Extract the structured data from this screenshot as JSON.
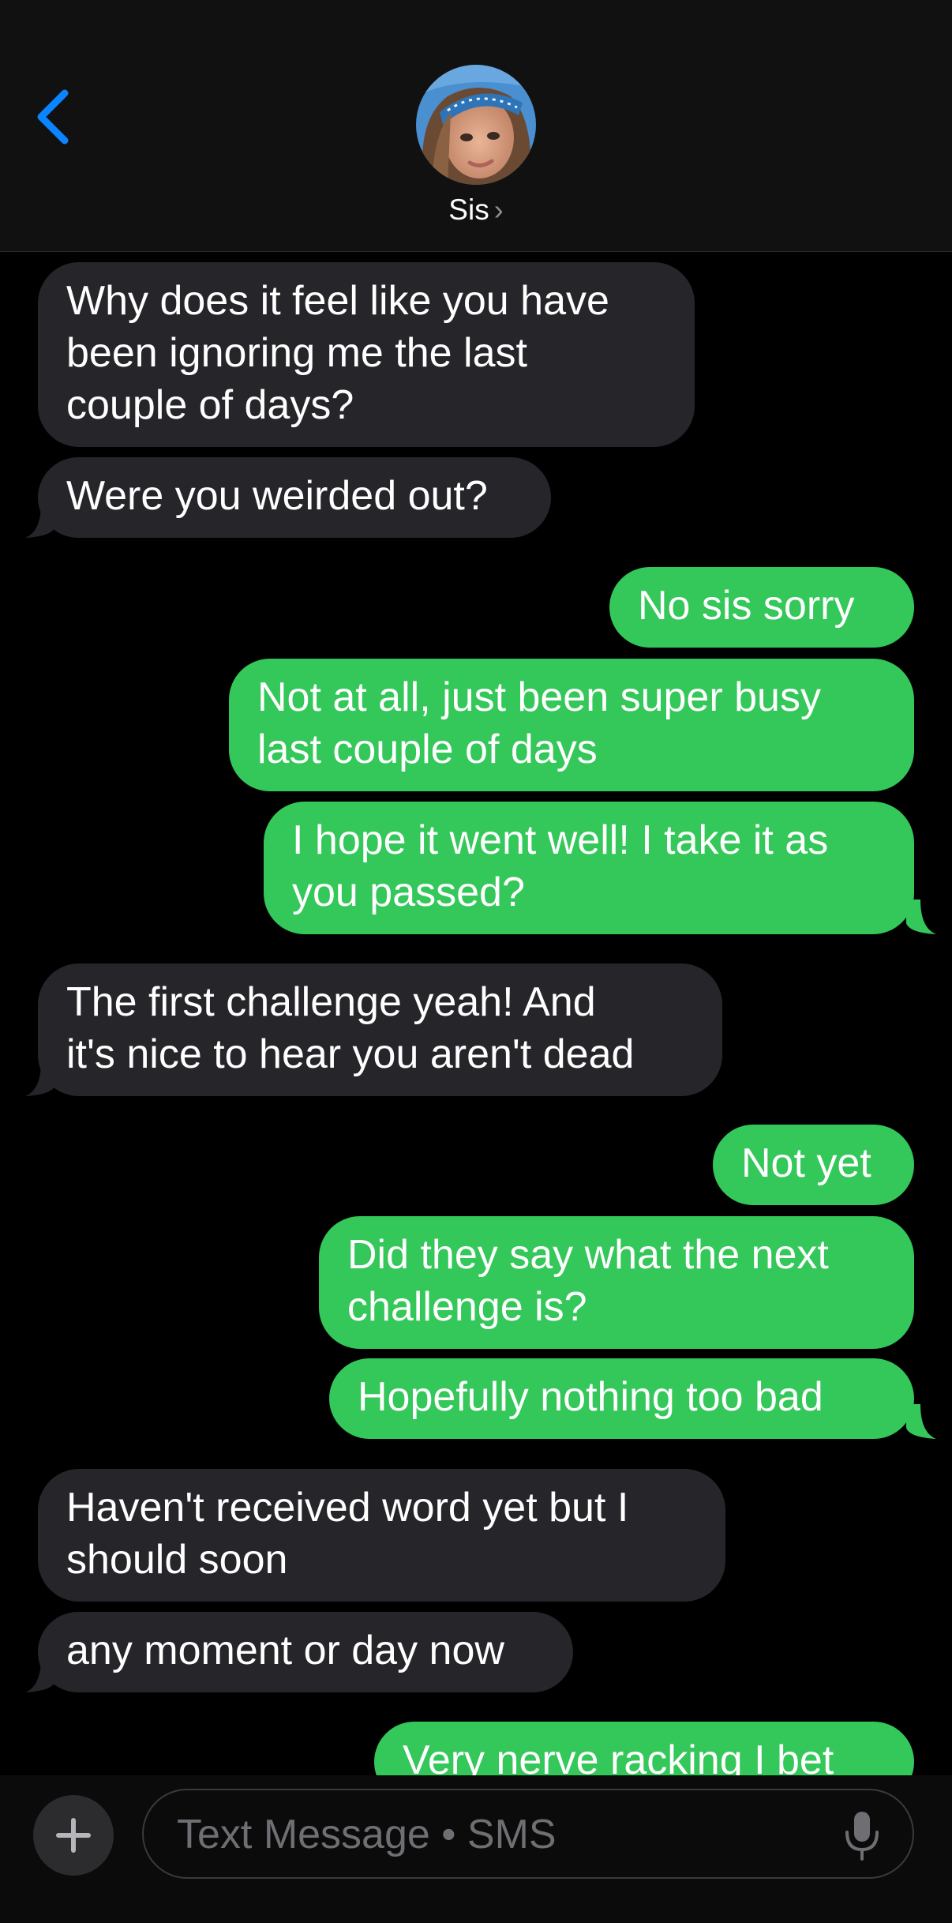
{
  "header": {
    "contact_name": "Sis",
    "avatar": "profile-photo"
  },
  "messages": [
    {
      "direction": "in",
      "text_lines": [
        "Why does it feel like you have",
        "been ignoring me the last",
        "couple of days?"
      ]
    },
    {
      "direction": "in",
      "text_lines": [
        "Were you weirded out?"
      ]
    },
    {
      "direction": "out",
      "text_lines": [
        "No sis sorry"
      ]
    },
    {
      "direction": "out",
      "text_lines": [
        "Not at all, just been super busy",
        "last couple of days"
      ]
    },
    {
      "direction": "out",
      "text_lines": [
        "I hope it went well! I take it as",
        "you passed?"
      ]
    },
    {
      "direction": "in",
      "text_lines": [
        "The first challenge yeah! And",
        "it's nice to hear you aren't dead"
      ]
    },
    {
      "direction": "out",
      "text_lines": [
        "Not yet"
      ]
    },
    {
      "direction": "out",
      "text_lines": [
        "Did they say what the next",
        "challenge is?"
      ]
    },
    {
      "direction": "out",
      "text_lines": [
        "Hopefully nothing too bad"
      ]
    },
    {
      "direction": "in",
      "text_lines": [
        "Haven't received word yet but I",
        "should soon"
      ]
    },
    {
      "direction": "in",
      "text_lines": [
        "any moment or day now"
      ]
    },
    {
      "direction": "out",
      "text_lines": [
        "Very nerve racking I bet"
      ]
    }
  ],
  "composer": {
    "placeholder": "Text Message • SMS"
  },
  "colors": {
    "incoming": "#26252a",
    "outgoing": "#34c759",
    "accent": "#0a84ff"
  }
}
